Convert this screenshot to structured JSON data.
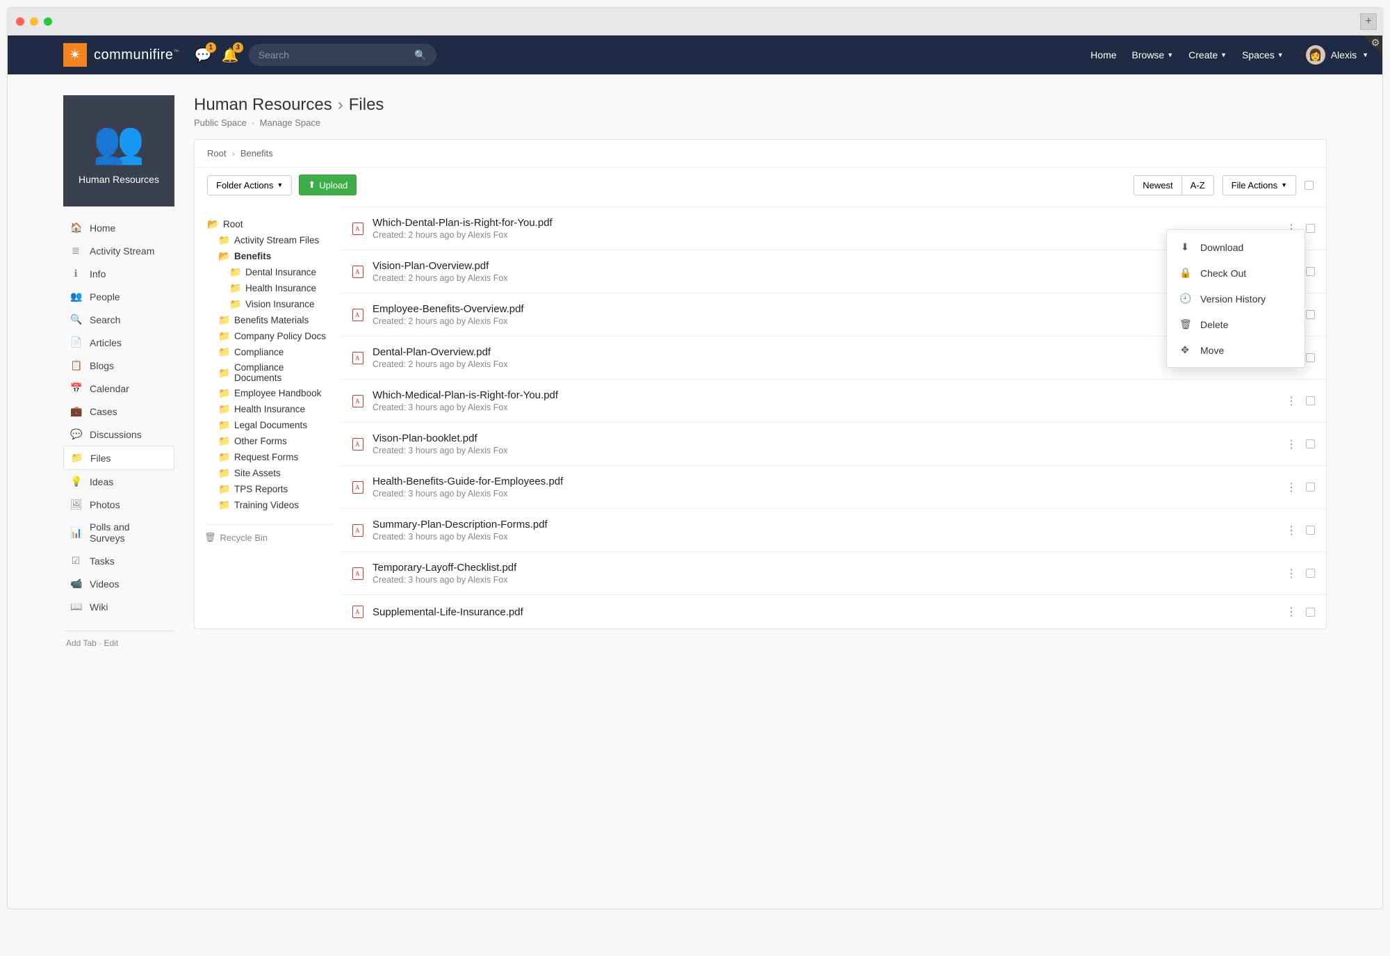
{
  "brand": "communifire",
  "notifications": {
    "chat": 1,
    "bell": 3
  },
  "search": {
    "placeholder": "Search"
  },
  "topnav": {
    "home": "Home",
    "browse": "Browse",
    "create": "Create",
    "spaces": "Spaces",
    "username": "Alexis"
  },
  "space": {
    "name": "Human Resources",
    "type": "Public Space",
    "manage": "Manage Space"
  },
  "page": {
    "title": "Human Resources",
    "section": "Files"
  },
  "sidenav": [
    {
      "icon": "🏠",
      "label": "Home"
    },
    {
      "icon": "≣",
      "label": "Activity Stream"
    },
    {
      "icon": "ℹ",
      "label": "Info"
    },
    {
      "icon": "👥",
      "label": "People"
    },
    {
      "icon": "🔍",
      "label": "Search"
    },
    {
      "icon": "📄",
      "label": "Articles"
    },
    {
      "icon": "📋",
      "label": "Blogs"
    },
    {
      "icon": "📅",
      "label": "Calendar"
    },
    {
      "icon": "💼",
      "label": "Cases"
    },
    {
      "icon": "💬",
      "label": "Discussions"
    },
    {
      "icon": "📁",
      "label": "Files",
      "active": true
    },
    {
      "icon": "💡",
      "label": "Ideas"
    },
    {
      "icon": "🖼",
      "label": "Photos"
    },
    {
      "icon": "📊",
      "label": "Polls and Surveys"
    },
    {
      "icon": "☑",
      "label": "Tasks"
    },
    {
      "icon": "📹",
      "label": "Videos"
    },
    {
      "icon": "📖",
      "label": "Wiki"
    }
  ],
  "side_footer": {
    "add": "Add Tab",
    "edit": "Edit"
  },
  "breadcrumb": {
    "root": "Root",
    "current": "Benefits"
  },
  "toolbar": {
    "folder_actions": "Folder Actions",
    "upload": "Upload",
    "newest": "Newest",
    "az": "A-Z",
    "file_actions": "File Actions"
  },
  "tree": {
    "root": "Root",
    "items": [
      {
        "label": "Activity Stream Files",
        "indent": 1
      },
      {
        "label": "Benefits",
        "indent": 1,
        "open": true,
        "bold": true
      },
      {
        "label": "Dental Insurance",
        "indent": 2
      },
      {
        "label": "Health Insurance",
        "indent": 2
      },
      {
        "label": "Vision Insurance",
        "indent": 2
      },
      {
        "label": "Benefits Materials",
        "indent": 1
      },
      {
        "label": "Company Policy Docs",
        "indent": 1
      },
      {
        "label": "Compliance",
        "indent": 1
      },
      {
        "label": "Compliance Documents",
        "indent": 1
      },
      {
        "label": "Employee Handbook",
        "indent": 1
      },
      {
        "label": "Health Insurance",
        "indent": 1
      },
      {
        "label": "Legal Documents",
        "indent": 1
      },
      {
        "label": "Other Forms",
        "indent": 1
      },
      {
        "label": "Request Forms",
        "indent": 1
      },
      {
        "label": "Site Assets",
        "indent": 1
      },
      {
        "label": "TPS Reports",
        "indent": 1
      },
      {
        "label": "Training Videos",
        "indent": 1
      }
    ],
    "recycle": "Recycle Bin"
  },
  "files": [
    {
      "name": "Which-Dental-Plan-is-Right-for-You.pdf",
      "meta": "Created: 2 hours ago by Alexis Fox",
      "menu": true
    },
    {
      "name": "Vision-Plan-Overview.pdf",
      "meta": "Created: 2 hours ago by Alexis Fox"
    },
    {
      "name": "Employee-Benefits-Overview.pdf",
      "meta": "Created: 2 hours ago by Alexis Fox"
    },
    {
      "name": "Dental-Plan-Overview.pdf",
      "meta": "Created: 2 hours ago by Alexis Fox"
    },
    {
      "name": "Which-Medical-Plan-is-Right-for-You.pdf",
      "meta": "Created: 3 hours ago by Alexis Fox"
    },
    {
      "name": "Vison-Plan-booklet.pdf",
      "meta": "Created: 3 hours ago by Alexis Fox"
    },
    {
      "name": "Health-Benefits-Guide-for-Employees.pdf",
      "meta": "Created: 3 hours ago by Alexis Fox"
    },
    {
      "name": "Summary-Plan-Description-Forms.pdf",
      "meta": "Created: 3 hours ago by Alexis Fox"
    },
    {
      "name": "Temporary-Layoff-Checklist.pdf",
      "meta": "Created: 3 hours ago by Alexis Fox"
    },
    {
      "name": "Supplemental-Life-Insurance.pdf",
      "meta": ""
    }
  ],
  "context_menu": [
    {
      "icon": "⬇",
      "label": "Download"
    },
    {
      "icon": "🔒",
      "label": "Check Out"
    },
    {
      "icon": "🕘",
      "label": "Version History"
    },
    {
      "icon": "🗑",
      "label": "Delete"
    },
    {
      "icon": "✥",
      "label": "Move"
    }
  ]
}
